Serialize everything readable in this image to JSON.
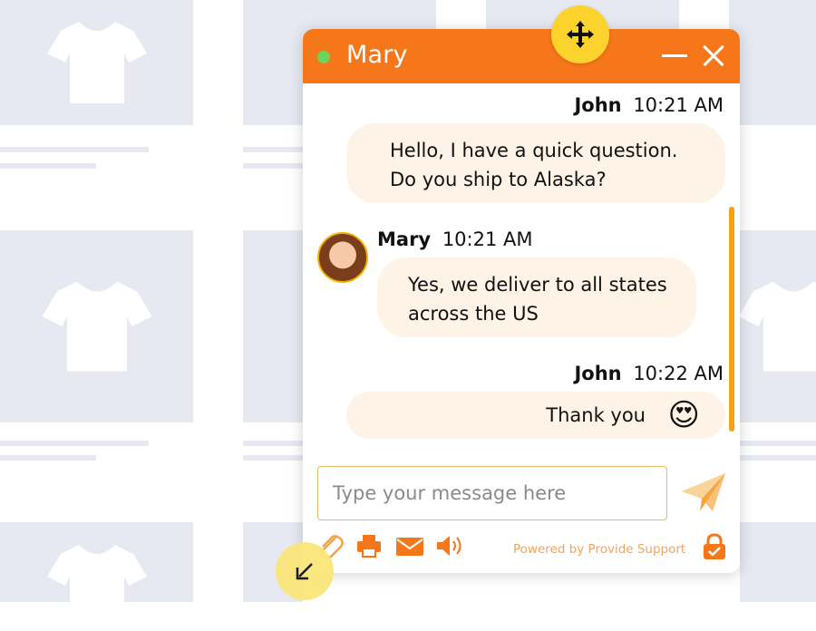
{
  "chat": {
    "agent_name": "Mary",
    "agent_status_color": "#6cd35b",
    "header_color": "#f6761a",
    "messages": [
      {
        "sender": "John",
        "time": "10:21 AM",
        "lines": [
          "Hello, I have a quick question.",
          "Do you ship to Alaska?"
        ]
      },
      {
        "sender": "Mary",
        "time": "10:21 AM",
        "lines": [
          "Yes, we deliver to all states",
          "across the US"
        ]
      },
      {
        "sender": "John",
        "time": "10:22 AM",
        "lines": [
          "Thank you"
        ],
        "emoji": "😍"
      }
    ],
    "input_placeholder": "Type your message here",
    "powered_by": "Powered by Provide Support"
  },
  "icons": {
    "move": "move-arrows-icon",
    "resize": "resize-arrow-icon",
    "minimize": "minimize-icon",
    "close": "close-icon",
    "send": "paper-plane-icon",
    "attach": "paperclip-icon",
    "print": "printer-icon",
    "email": "envelope-icon",
    "sound": "speaker-icon",
    "lock": "lock-icon"
  }
}
